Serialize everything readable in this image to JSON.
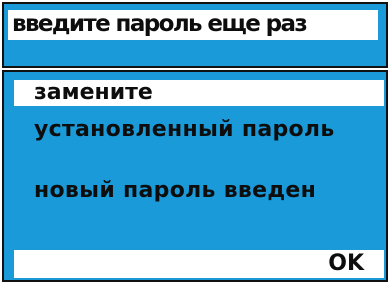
{
  "title": "введите пароль еще раз",
  "menu": {
    "selected_line1": "замените",
    "line2": "установленный пароль"
  },
  "status_message": "новый пароль введен",
  "ok_label": "OK",
  "colors": {
    "panel_background": "#1a9ad8",
    "highlight": "#ffffff",
    "text": "#0d0d0d",
    "border": "#111111"
  }
}
